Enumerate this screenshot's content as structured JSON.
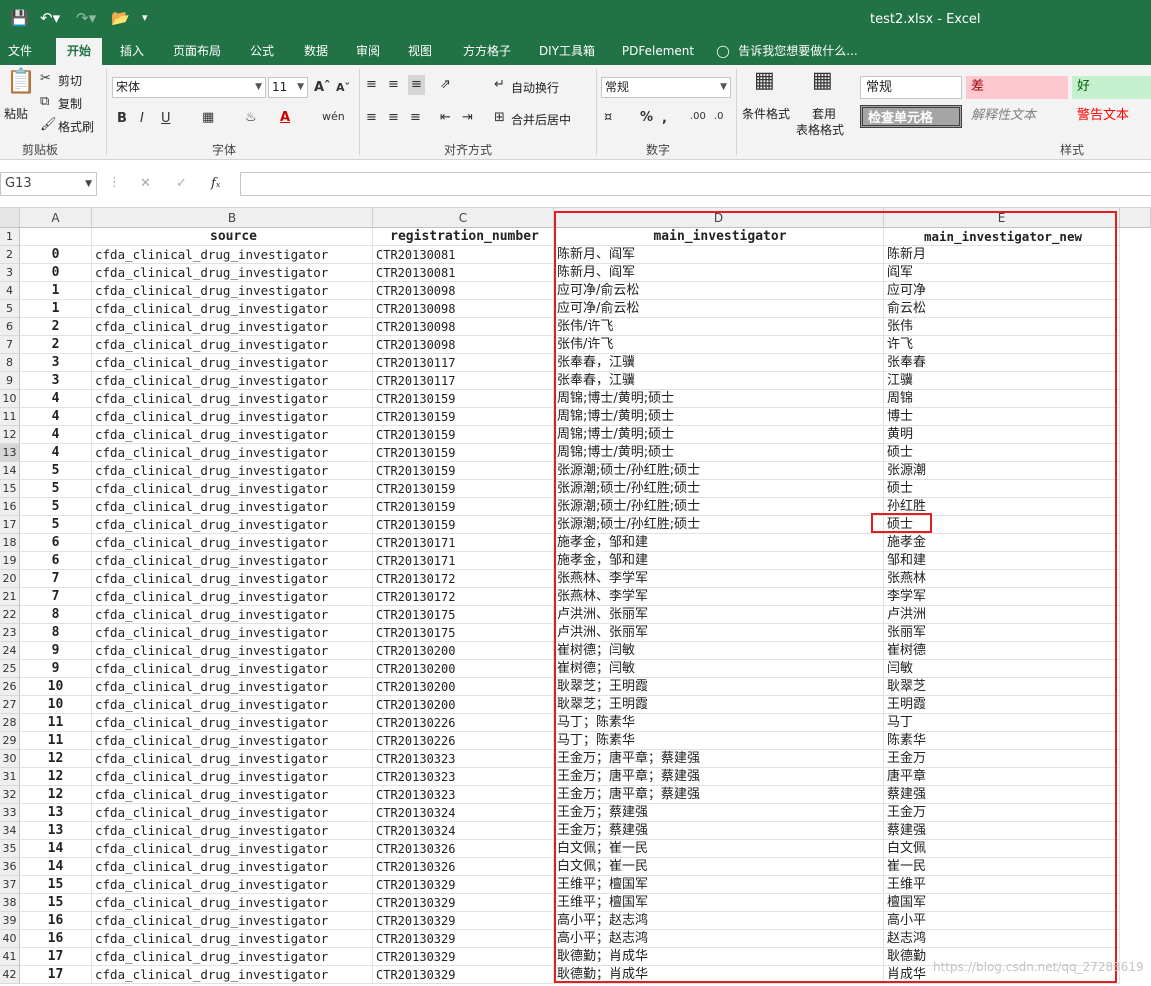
{
  "window": {
    "title": "test2.xlsx - Excel"
  },
  "tabs": [
    "文件",
    "开始",
    "插入",
    "页面布局",
    "公式",
    "数据",
    "审阅",
    "视图",
    "方方格子",
    "DIY工具箱",
    "PDFelement",
    "告诉我您想要做什么..."
  ],
  "ribbon": {
    "clipboard": {
      "paste": "粘贴",
      "cut": "剪切",
      "copy": "复制",
      "format_painter": "格式刷",
      "label": "剪贴板"
    },
    "font": {
      "name": "宋体",
      "size": "11",
      "label": "字体"
    },
    "alignment": {
      "wrap": "自动换行",
      "merge": "合并后居中",
      "label": "对齐方式"
    },
    "number": {
      "format": "常规",
      "label": "数字"
    },
    "styles": {
      "cond_format": "条件格式",
      "table_format_1": "套用",
      "table_format_2": "表格格式",
      "normal": "常规",
      "bad": "差",
      "good": "好",
      "check_cell": "检查单元格",
      "explanatory": "解释性文本",
      "warning": "警告文本",
      "label": "样式"
    }
  },
  "formula_bar": {
    "name_box": "G13",
    "value": ""
  },
  "sheet": {
    "columns": [
      "A",
      "B",
      "C",
      "D",
      "E"
    ],
    "header": {
      "b": "source",
      "c": "registration_number",
      "d": "main_investigator",
      "e": "main_investigator_new"
    },
    "rows": [
      {
        "n": "2",
        "a": "0",
        "b": "cfda_clinical_drug_investigator",
        "c": "CTR20130081",
        "d": "陈新月、阎军",
        "e": "陈新月"
      },
      {
        "n": "3",
        "a": "0",
        "b": "cfda_clinical_drug_investigator",
        "c": "CTR20130081",
        "d": "陈新月、阎军",
        "e": "阎军"
      },
      {
        "n": "4",
        "a": "1",
        "b": "cfda_clinical_drug_investigator",
        "c": "CTR20130098",
        "d": "应可净/俞云松",
        "e": "应可净"
      },
      {
        "n": "5",
        "a": "1",
        "b": "cfda_clinical_drug_investigator",
        "c": "CTR20130098",
        "d": "应可净/俞云松",
        "e": "俞云松"
      },
      {
        "n": "6",
        "a": "2",
        "b": "cfda_clinical_drug_investigator",
        "c": "CTR20130098",
        "d": "张伟/许飞",
        "e": "张伟"
      },
      {
        "n": "7",
        "a": "2",
        "b": "cfda_clinical_drug_investigator",
        "c": "CTR20130098",
        "d": "张伟/许飞",
        "e": "许飞"
      },
      {
        "n": "8",
        "a": "3",
        "b": "cfda_clinical_drug_investigator",
        "c": "CTR20130117",
        "d": "张奉春，江骥",
        "e": "张奉春"
      },
      {
        "n": "9",
        "a": "3",
        "b": "cfda_clinical_drug_investigator",
        "c": "CTR20130117",
        "d": "张奉春，江骥",
        "e": "江骥"
      },
      {
        "n": "10",
        "a": "4",
        "b": "cfda_clinical_drug_investigator",
        "c": "CTR20130159",
        "d": "周锦;博士/黄明;硕士",
        "e": "周锦"
      },
      {
        "n": "11",
        "a": "4",
        "b": "cfda_clinical_drug_investigator",
        "c": "CTR20130159",
        "d": "周锦;博士/黄明;硕士",
        "e": "博士"
      },
      {
        "n": "12",
        "a": "4",
        "b": "cfda_clinical_drug_investigator",
        "c": "CTR20130159",
        "d": "周锦;博士/黄明;硕士",
        "e": "黄明"
      },
      {
        "n": "13",
        "a": "4",
        "b": "cfda_clinical_drug_investigator",
        "c": "CTR20130159",
        "d": "周锦;博士/黄明;硕士",
        "e": "硕士"
      },
      {
        "n": "14",
        "a": "5",
        "b": "cfda_clinical_drug_investigator",
        "c": "CTR20130159",
        "d": "张源潮;硕士/孙红胜;硕士",
        "e": "张源潮"
      },
      {
        "n": "15",
        "a": "5",
        "b": "cfda_clinical_drug_investigator",
        "c": "CTR20130159",
        "d": "张源潮;硕士/孙红胜;硕士",
        "e": "硕士"
      },
      {
        "n": "16",
        "a": "5",
        "b": "cfda_clinical_drug_investigator",
        "c": "CTR20130159",
        "d": "张源潮;硕士/孙红胜;硕士",
        "e": "孙红胜"
      },
      {
        "n": "17",
        "a": "5",
        "b": "cfda_clinical_drug_investigator",
        "c": "CTR20130159",
        "d": "张源潮;硕士/孙红胜;硕士",
        "e": "硕士"
      },
      {
        "n": "18",
        "a": "6",
        "b": "cfda_clinical_drug_investigator",
        "c": "CTR20130171",
        "d": "施孝金，邹和建",
        "e": "施孝金"
      },
      {
        "n": "19",
        "a": "6",
        "b": "cfda_clinical_drug_investigator",
        "c": "CTR20130171",
        "d": "施孝金，邹和建",
        "e": "邹和建"
      },
      {
        "n": "20",
        "a": "7",
        "b": "cfda_clinical_drug_investigator",
        "c": "CTR20130172",
        "d": "张燕林、李学军",
        "e": "张燕林"
      },
      {
        "n": "21",
        "a": "7",
        "b": "cfda_clinical_drug_investigator",
        "c": "CTR20130172",
        "d": "张燕林、李学军",
        "e": "李学军"
      },
      {
        "n": "22",
        "a": "8",
        "b": "cfda_clinical_drug_investigator",
        "c": "CTR20130175",
        "d": "卢洪洲、张丽军",
        "e": "卢洪洲"
      },
      {
        "n": "23",
        "a": "8",
        "b": "cfda_clinical_drug_investigator",
        "c": "CTR20130175",
        "d": "卢洪洲、张丽军",
        "e": "张丽军"
      },
      {
        "n": "24",
        "a": "9",
        "b": "cfda_clinical_drug_investigator",
        "c": "CTR20130200",
        "d": "崔树德；闫敏",
        "e": "崔树德"
      },
      {
        "n": "25",
        "a": "9",
        "b": "cfda_clinical_drug_investigator",
        "c": "CTR20130200",
        "d": "崔树德；闫敏",
        "e": "闫敏"
      },
      {
        "n": "26",
        "a": "10",
        "b": "cfda_clinical_drug_investigator",
        "c": "CTR20130200",
        "d": "耿翠芝；王明霞",
        "e": "耿翠芝"
      },
      {
        "n": "27",
        "a": "10",
        "b": "cfda_clinical_drug_investigator",
        "c": "CTR20130200",
        "d": "耿翠芝；王明霞",
        "e": "王明霞"
      },
      {
        "n": "28",
        "a": "11",
        "b": "cfda_clinical_drug_investigator",
        "c": "CTR20130226",
        "d": "马丁；陈素华",
        "e": "马丁"
      },
      {
        "n": "29",
        "a": "11",
        "b": "cfda_clinical_drug_investigator",
        "c": "CTR20130226",
        "d": "马丁；陈素华",
        "e": "陈素华"
      },
      {
        "n": "30",
        "a": "12",
        "b": "cfda_clinical_drug_investigator",
        "c": "CTR20130323",
        "d": "王金万；唐平章；蔡建强",
        "e": "王金万"
      },
      {
        "n": "31",
        "a": "12",
        "b": "cfda_clinical_drug_investigator",
        "c": "CTR20130323",
        "d": "王金万；唐平章；蔡建强",
        "e": "唐平章"
      },
      {
        "n": "32",
        "a": "12",
        "b": "cfda_clinical_drug_investigator",
        "c": "CTR20130323",
        "d": "王金万；唐平章；蔡建强",
        "e": "蔡建强"
      },
      {
        "n": "33",
        "a": "13",
        "b": "cfda_clinical_drug_investigator",
        "c": "CTR20130324",
        "d": "王金万；蔡建强",
        "e": "王金万"
      },
      {
        "n": "34",
        "a": "13",
        "b": "cfda_clinical_drug_investigator",
        "c": "CTR20130324",
        "d": "王金万；蔡建强",
        "e": "蔡建强"
      },
      {
        "n": "35",
        "a": "14",
        "b": "cfda_clinical_drug_investigator",
        "c": "CTR20130326",
        "d": "白文佩；崔一民",
        "e": "白文佩"
      },
      {
        "n": "36",
        "a": "14",
        "b": "cfda_clinical_drug_investigator",
        "c": "CTR20130326",
        "d": "白文佩；崔一民",
        "e": "崔一民"
      },
      {
        "n": "37",
        "a": "15",
        "b": "cfda_clinical_drug_investigator",
        "c": "CTR20130329",
        "d": "王维平；檀国军",
        "e": "王维平"
      },
      {
        "n": "38",
        "a": "15",
        "b": "cfda_clinical_drug_investigator",
        "c": "CTR20130329",
        "d": "王维平；檀国军",
        "e": "檀国军"
      },
      {
        "n": "39",
        "a": "16",
        "b": "cfda_clinical_drug_investigator",
        "c": "CTR20130329",
        "d": "高小平；赵志鸿",
        "e": "高小平"
      },
      {
        "n": "40",
        "a": "16",
        "b": "cfda_clinical_drug_investigator",
        "c": "CTR20130329",
        "d": "高小平；赵志鸿",
        "e": "赵志鸿"
      },
      {
        "n": "41",
        "a": "17",
        "b": "cfda_clinical_drug_investigator",
        "c": "CTR20130329",
        "d": "耿德勤；肖成华",
        "e": "耿德勤"
      },
      {
        "n": "42",
        "a": "17",
        "b": "cfda_clinical_drug_investigator",
        "c": "CTR20130329",
        "d": "耿德勤；肖成华",
        "e": "肖成华"
      }
    ]
  },
  "watermark": "https://blog.csdn.net/qq_27283619",
  "colors": {
    "accent": "#217346",
    "highlight": "#e02020",
    "bad_fill": "#ffc7ce",
    "good_fill": "#c6efce",
    "check_fill": "#a5a5a5"
  }
}
